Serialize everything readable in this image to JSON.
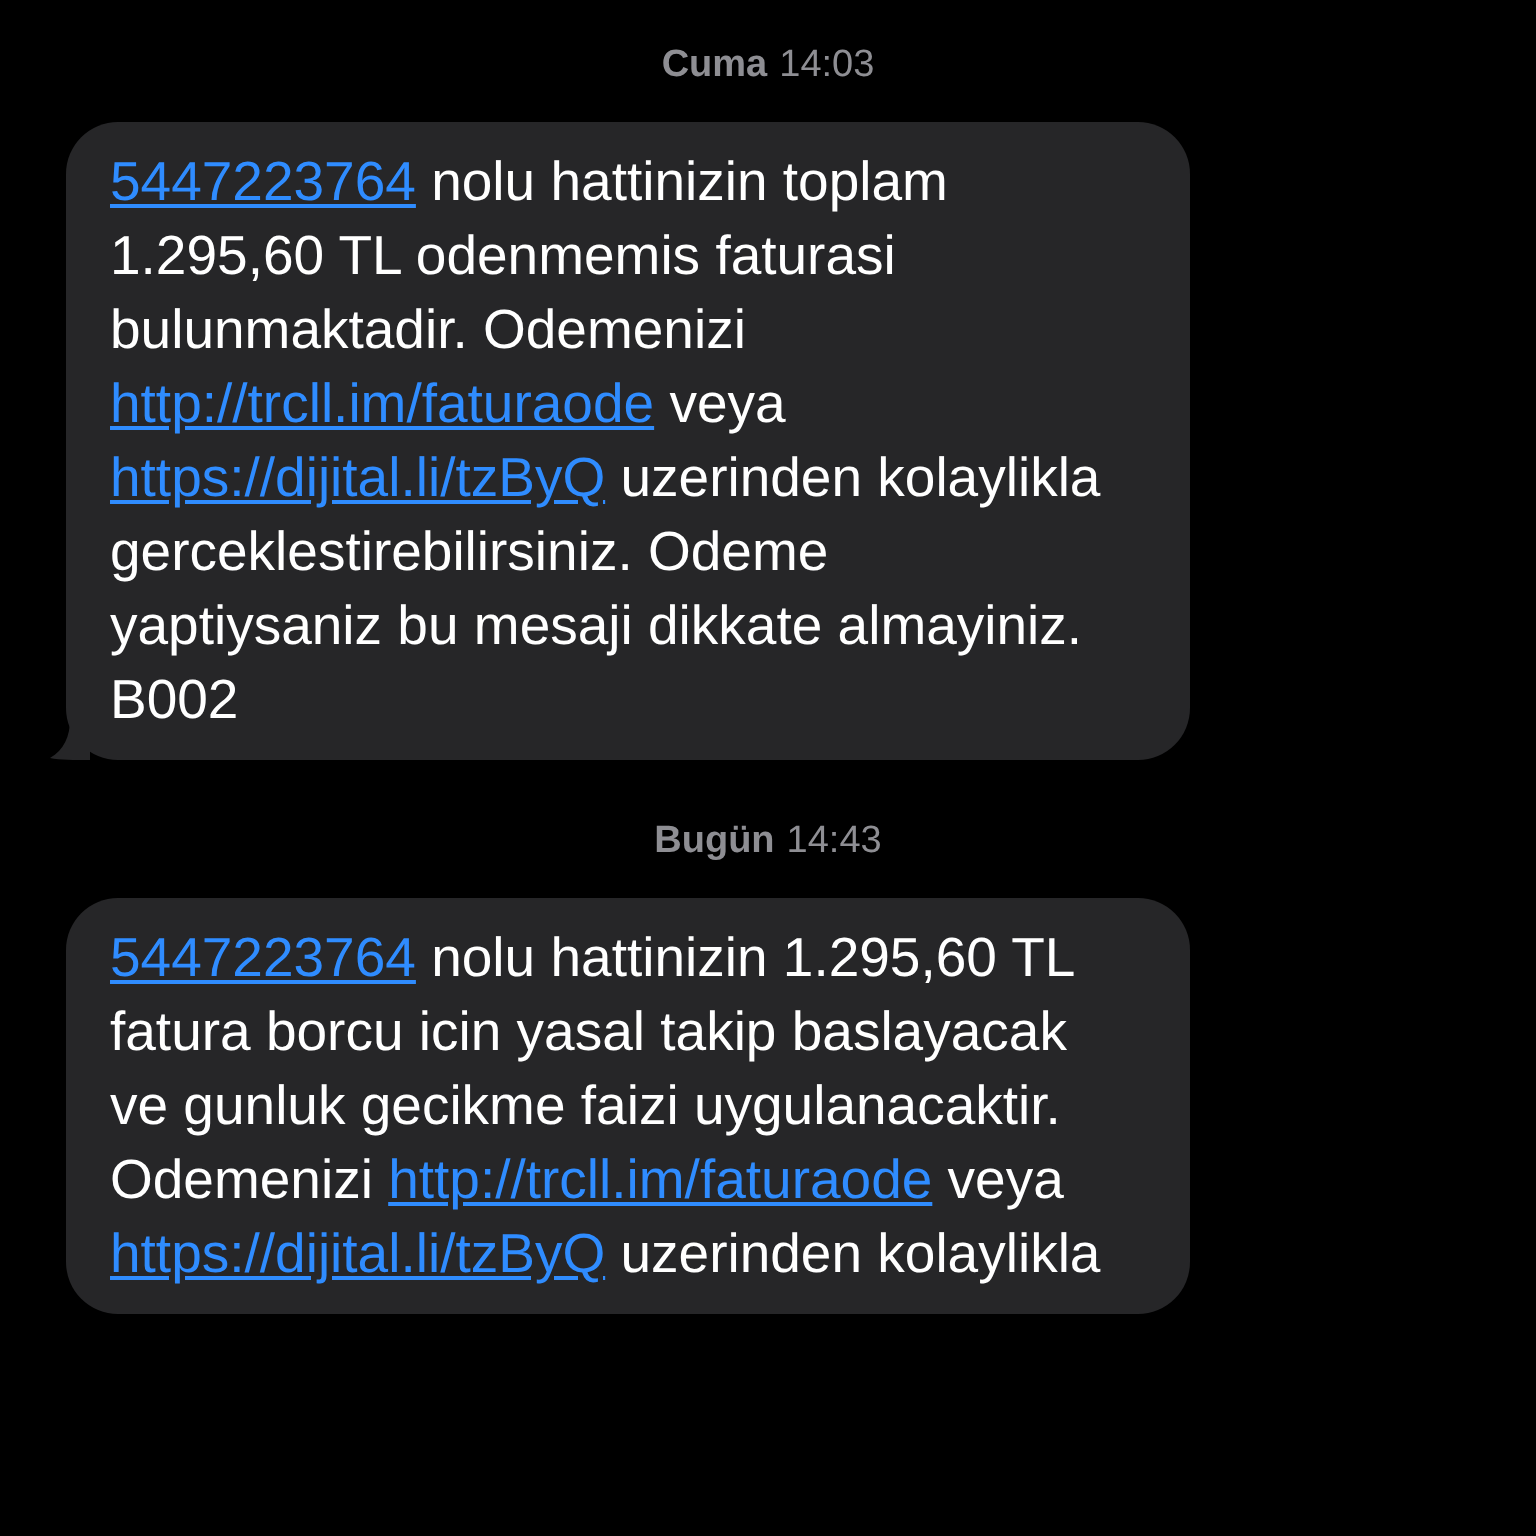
{
  "messages": [
    {
      "timestamp": {
        "day": "Cuma",
        "time": "14:03"
      },
      "tail": true,
      "segments": [
        {
          "kind": "link",
          "text": "5447223764"
        },
        {
          "kind": "text",
          "text": " nolu hattinizin toplam 1.295,60 TL odenmemis faturasi bulunmaktadir. Odemenizi "
        },
        {
          "kind": "link",
          "text": "http://trcll.im/faturaode"
        },
        {
          "kind": "text",
          "text": " veya "
        },
        {
          "kind": "link",
          "text": "https://dijital.li/tzByQ"
        },
        {
          "kind": "text",
          "text": " uzerinden kolaylikla gerceklestirebilirsiniz. Odeme yaptiysaniz bu mesaji dikkate almayiniz. B002"
        }
      ]
    },
    {
      "timestamp": {
        "day": "Bugün",
        "time": "14:43"
      },
      "tail": false,
      "segments": [
        {
          "kind": "link",
          "text": "5447223764"
        },
        {
          "kind": "text",
          "text": " nolu hattinizin 1.295,60 TL fatura borcu icin yasal takip baslayacak ve gunluk gecikme faizi uygulanacaktir. Odemenizi "
        },
        {
          "kind": "link",
          "text": "http://trcll.im/faturaode"
        },
        {
          "kind": "text",
          "text": " veya "
        },
        {
          "kind": "link",
          "text": "https://dijital.li/tzByQ"
        },
        {
          "kind": "text",
          "text": " uzerinden kolaylikla"
        }
      ]
    }
  ]
}
